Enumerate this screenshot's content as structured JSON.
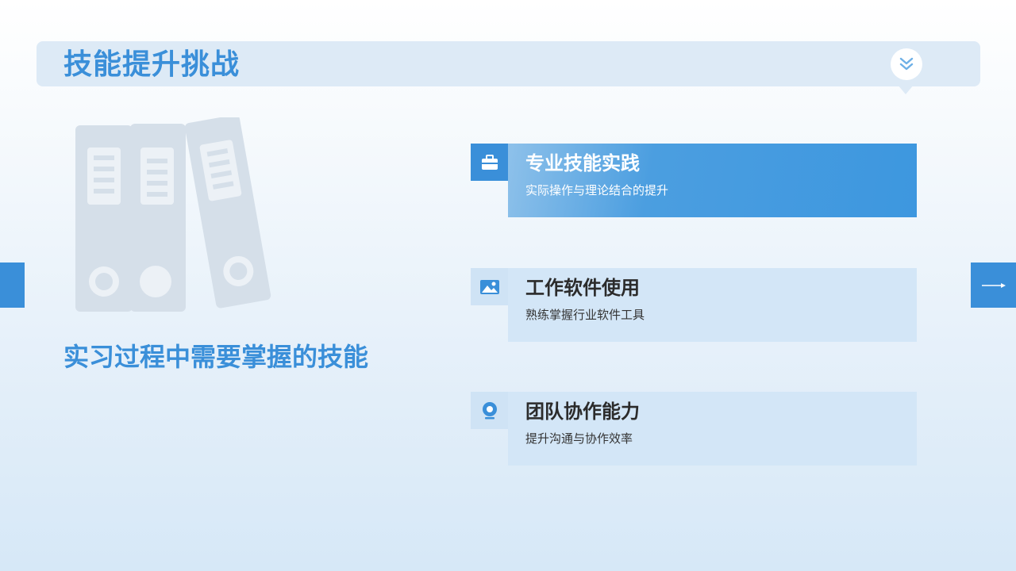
{
  "header": {
    "title": "技能提升挑战",
    "badge_icon": "double-chevron-down-icon"
  },
  "illustration": {
    "icon": "binders-icon"
  },
  "subtitle": "实习过程中需要掌握的技能",
  "cards": [
    {
      "title": "专业技能实践",
      "description": "实际操作与理论结合的提升",
      "icon": "briefcase-icon",
      "active": true
    },
    {
      "title": "工作软件使用",
      "description": "熟练掌握行业软件工具",
      "icon": "image-icon",
      "active": false
    },
    {
      "title": "团队协作能力",
      "description": "提升沟通与协作效率",
      "icon": "location-pin-icon",
      "active": false
    }
  ],
  "navigation": {
    "next_icon": "arrow-right-icon"
  },
  "colors": {
    "accent": "#3a8fd9",
    "card_bg": "#d3e6f7",
    "title_bar_bg": "#ddeaf6"
  }
}
